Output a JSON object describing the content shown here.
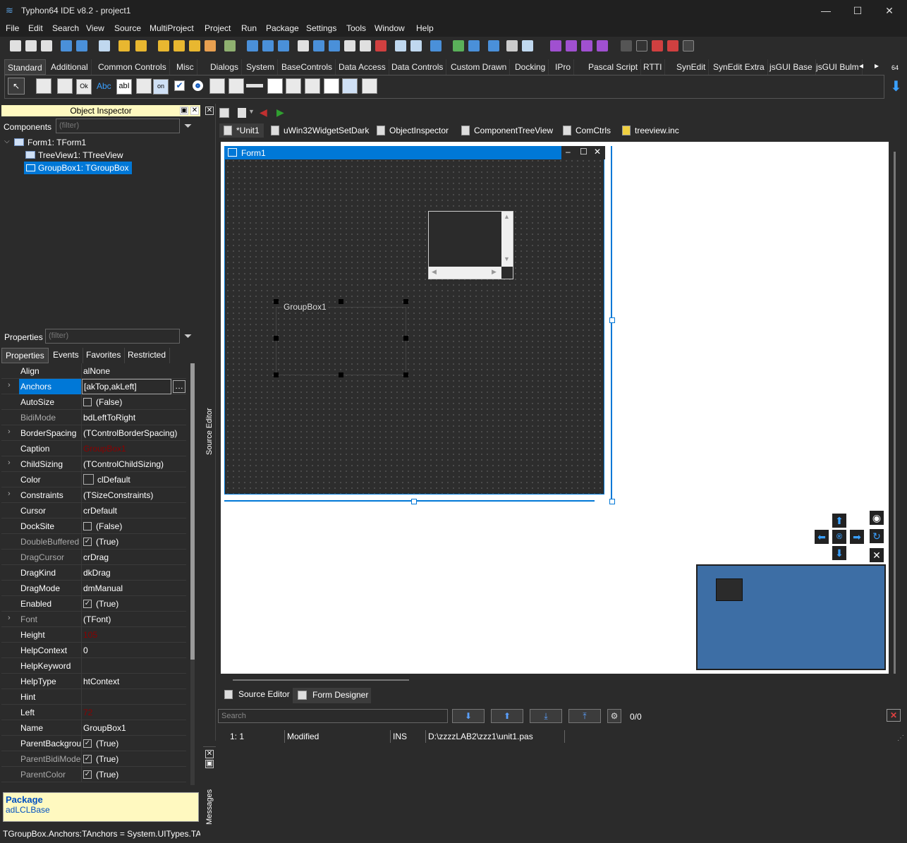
{
  "window": {
    "title": "Typhon64 IDE v8.2 - project1",
    "minimize": "—",
    "maximize": "☐",
    "close": "✕"
  },
  "menu": [
    "File",
    "Edit",
    "Search",
    "View",
    "Source",
    "MultiProject",
    "Project",
    "Run",
    "Package",
    "Settings",
    "Tools",
    "Window",
    "Help"
  ],
  "palette": {
    "tabs": [
      "Standard",
      "Additional",
      "Common Controls",
      "Misc",
      "Dialogs",
      "System",
      "BaseControls",
      "Data Access",
      "Data Controls",
      "Custom Drawn",
      "Docking",
      "IPro",
      "Pascal Script",
      "RTTI",
      "SynEdit",
      "SynEdit Extra",
      "jsGUI Base",
      "jsGUI Bulm"
    ],
    "active_tab": "Standard",
    "badge": "64",
    "component_labels": {
      "ok": "Ok",
      "abc": "Abc",
      "abi": "abI",
      "on": "on"
    }
  },
  "object_inspector": {
    "title": "Object Inspector",
    "components_label": "Components",
    "filter_placeholder": "(filter)",
    "tree": [
      "Form1: TForm1",
      "TreeView1: TTreeView",
      "GroupBox1: TGroupBox"
    ],
    "properties_label": "Properties",
    "tabs": [
      "Properties",
      "Events",
      "Favorites",
      "Restricted"
    ],
    "rows": [
      {
        "name": "Align",
        "value": "alNone"
      },
      {
        "name": "Anchors",
        "value": "[akTop,akLeft]"
      },
      {
        "name": "AutoSize",
        "value": "(False)"
      },
      {
        "name": "BidiMode",
        "value": "bdLeftToRight"
      },
      {
        "name": "BorderSpacing",
        "value": "(TControlBorderSpacing)"
      },
      {
        "name": "Caption",
        "value": "GroupBox1"
      },
      {
        "name": "ChildSizing",
        "value": "(TControlChildSizing)"
      },
      {
        "name": "Color",
        "value": "clDefault"
      },
      {
        "name": "Constraints",
        "value": "(TSizeConstraints)"
      },
      {
        "name": "Cursor",
        "value": "crDefault"
      },
      {
        "name": "DockSite",
        "value": "(False)"
      },
      {
        "name": "DoubleBuffered",
        "value": "(True)"
      },
      {
        "name": "DragCursor",
        "value": "crDrag"
      },
      {
        "name": "DragKind",
        "value": "dkDrag"
      },
      {
        "name": "DragMode",
        "value": "dmManual"
      },
      {
        "name": "Enabled",
        "value": "(True)"
      },
      {
        "name": "Font",
        "value": "(TFont)"
      },
      {
        "name": "Height",
        "value": "105"
      },
      {
        "name": "HelpContext",
        "value": "0"
      },
      {
        "name": "HelpKeyword",
        "value": ""
      },
      {
        "name": "HelpType",
        "value": "htContext"
      },
      {
        "name": "Hint",
        "value": ""
      },
      {
        "name": "Left",
        "value": "72"
      },
      {
        "name": "Name",
        "value": "GroupBox1"
      },
      {
        "name": "ParentBackgrou",
        "value": "(True)"
      },
      {
        "name": "ParentBidiMode",
        "value": "(True)"
      },
      {
        "name": "ParentColor",
        "value": "(True)"
      }
    ],
    "info_title": "Package",
    "info_value": "adLCLBase",
    "status": "TGroupBox.Anchors:TAnchors = System.UITypes.TAn"
  },
  "editor": {
    "tabs": [
      "*Unit1",
      "uWin32WidgetSetDark",
      "ObjectInspector",
      "ComponentTreeView",
      "ComCtrls",
      "treeview.inc"
    ],
    "form_caption": "Form1",
    "groupbox_caption": "GroupBox1",
    "source_editor_label": "Source Editor",
    "bottom_tabs": [
      "Source Editor",
      "Form Designer"
    ],
    "search_placeholder": "Search",
    "search_count": "0/0",
    "status": {
      "pos": "1:   1",
      "modified": "Modified",
      "mode": "INS",
      "file": "D:\\zzzzLAB2\\zzz1\\unit1.pas"
    }
  },
  "messages": {
    "label": "Messages"
  }
}
